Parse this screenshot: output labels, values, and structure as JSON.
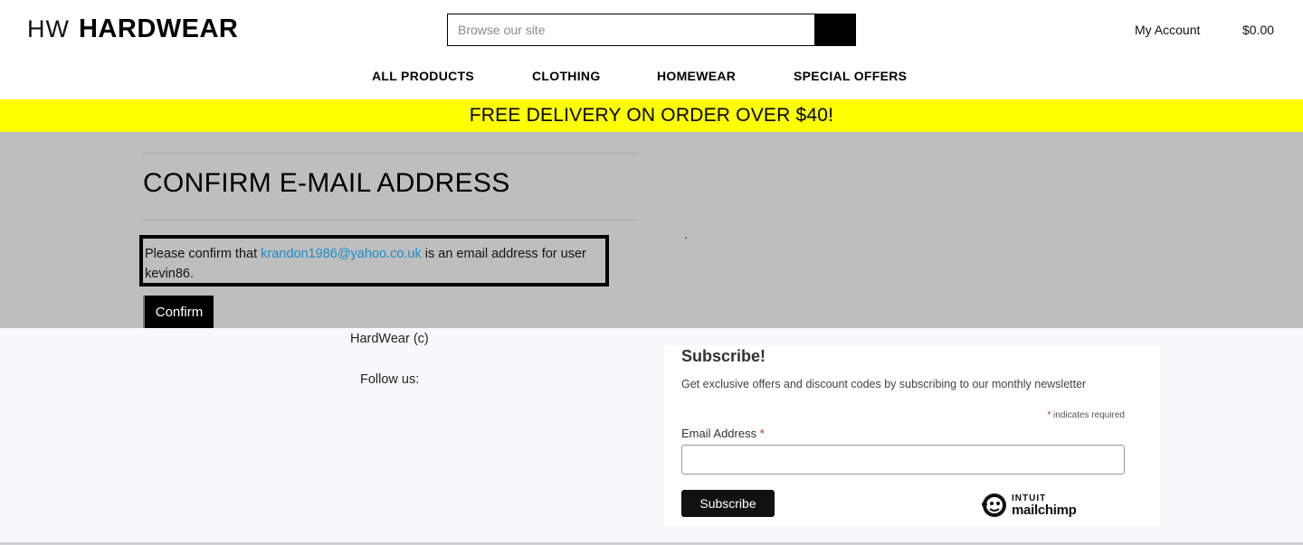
{
  "header": {
    "logo_mark": "HW",
    "logo_name": "HARDWEAR",
    "search_placeholder": "Browse our site",
    "account_label": "My Account",
    "cart_total": "$0.00"
  },
  "nav": {
    "items": [
      {
        "label": "ALL PRODUCTS"
      },
      {
        "label": "CLOTHING"
      },
      {
        "label": "HOMEWEAR"
      },
      {
        "label": "SPECIAL OFFERS"
      }
    ]
  },
  "promo": {
    "text": "FREE DELIVERY ON ORDER OVER $40!"
  },
  "main": {
    "title": "CONFIRM E-MAIL ADDRESS",
    "message_prefix": "Please confirm that ",
    "email": "krandon1986@yahoo.co.uk",
    "message_suffix": " is an email address for user kevin86.",
    "dot": ".",
    "confirm_label": "Confirm"
  },
  "footer": {
    "copyright": "HardWear (c)",
    "follow": "Follow us:"
  },
  "subscribe": {
    "title": "Subscribe!",
    "description": "Get exclusive offers and discount codes by subscribing to our monthly newsletter",
    "required_star": "*",
    "required_note": " indicates required",
    "email_label": "Email Address ",
    "email_value": "",
    "button_label": "Subscribe",
    "badge_top": "INTUIT",
    "badge_name": "mailchimp"
  },
  "colors": {
    "promo_bg": "#ffff00",
    "main_bg": "#bebebe",
    "link": "#1a8ccc",
    "footer_bg": "#f7f8fa"
  }
}
